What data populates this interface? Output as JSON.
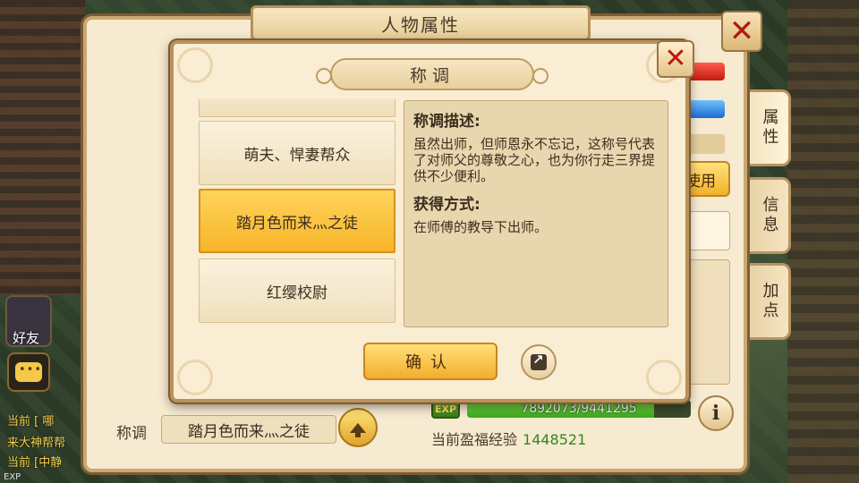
{
  "main_window": {
    "title": "人物属性",
    "tabs": [
      {
        "label": "属性",
        "active": true
      },
      {
        "label": "信息",
        "active": false
      },
      {
        "label": "加点",
        "active": false
      }
    ],
    "use_button_label": "使用",
    "exp": {
      "label": "EXP",
      "current": 7892073,
      "max": 9441295,
      "text": "7892073/9441295"
    },
    "blessing_label": "当前盈福经验",
    "blessing_value": "1448521",
    "info_icon_glyph": "i",
    "title_row": {
      "label": "称调",
      "value": "踏月色而来灬之徒"
    }
  },
  "title_modal": {
    "header": "称调",
    "list": [
      {
        "label": "萌夫、悍妻帮众",
        "selected": false
      },
      {
        "label": "踏月色而来灬之徒",
        "selected": true
      },
      {
        "label": "红缨校尉",
        "selected": false
      }
    ],
    "description_heading": "称调描述:",
    "description": "虽然出师，但师恩永不忘记，这称号代表了对师父的尊敬之心，也为你行走三界提供不少便利。",
    "obtain_heading": "获得方式:",
    "obtain_text": "在师傅的教导下出师。",
    "confirm_label": "确认"
  },
  "hud": {
    "friends_label": "好友",
    "exp_small": "EXP",
    "log_lines": [
      {
        "text": "当前 [   哪",
        "color": "#f5d04a"
      },
      {
        "text": "来大神帮帮",
        "color": "#f5d04a"
      },
      {
        "text": "当前 [中静",
        "color": "#f5d04a"
      }
    ]
  },
  "colors": {
    "accent_gold": "#f7b52a",
    "panel_bg": "#f9edd3",
    "close_red": "#c0140c",
    "exp_green": "#3aa81c"
  }
}
